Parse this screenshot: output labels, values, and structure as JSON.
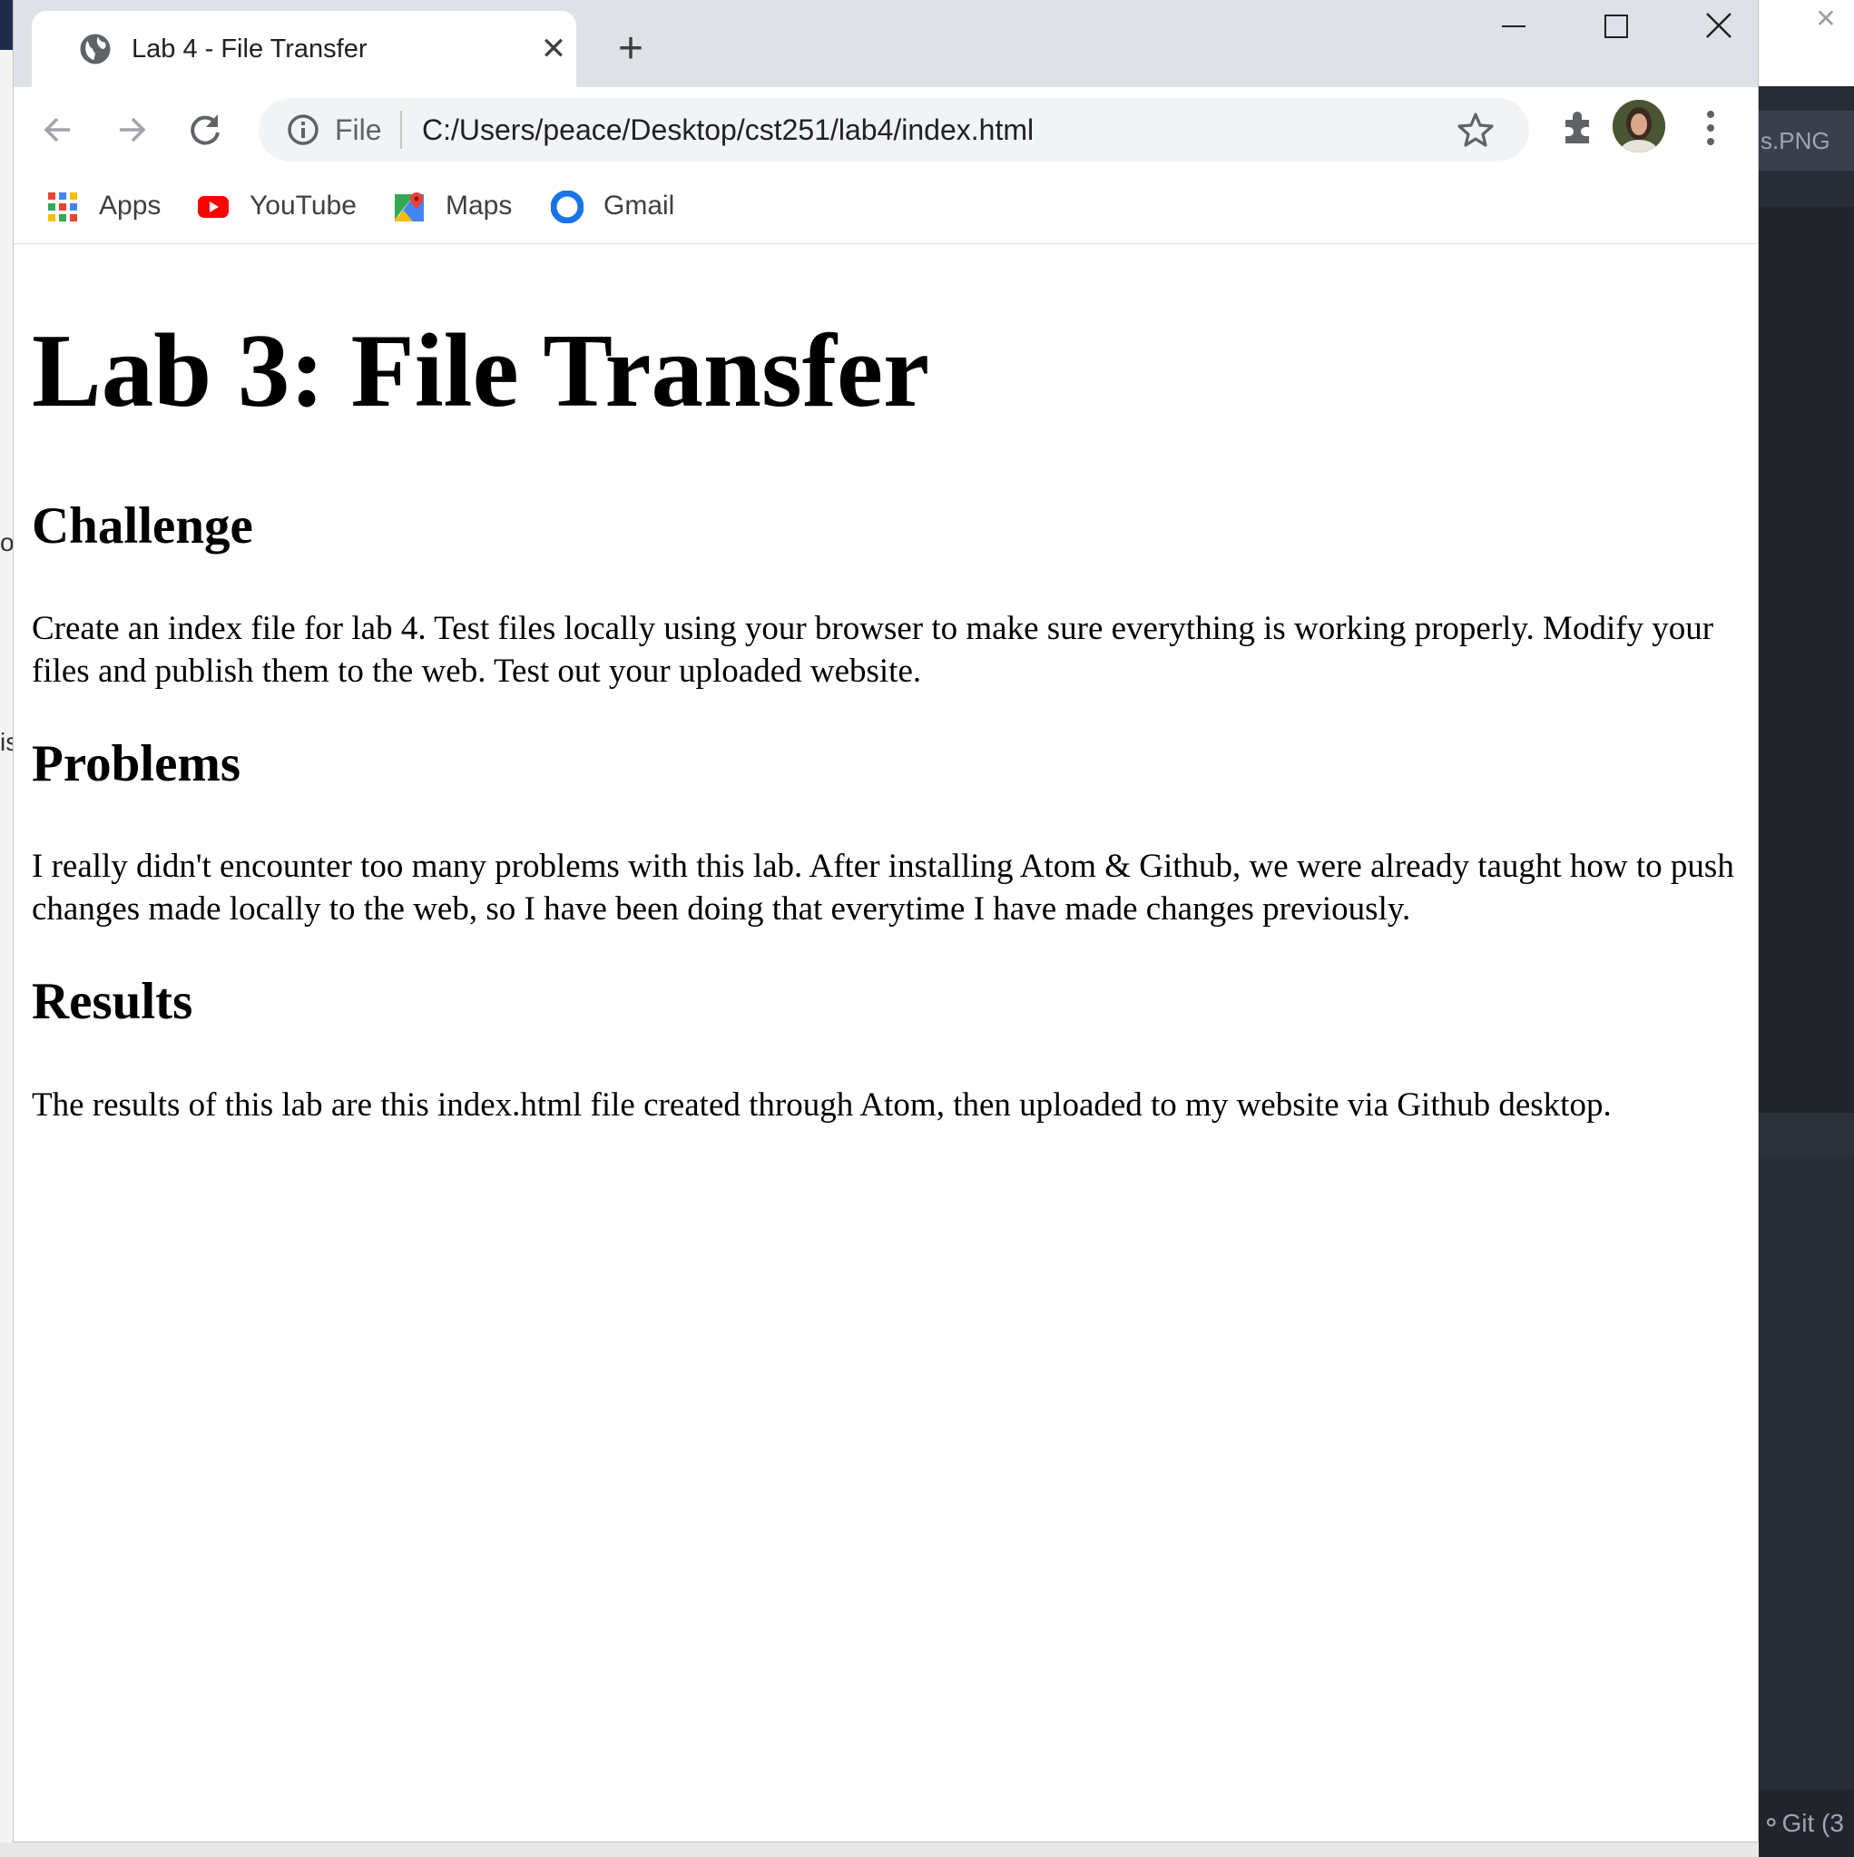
{
  "background": {
    "right_tab_label": "s.PNG",
    "status_git": "Git (3",
    "left_char_1": "o",
    "left_char_2": "is"
  },
  "browser": {
    "tab": {
      "title": "Lab 4 - File Transfer",
      "favicon": "globe-icon"
    },
    "address_bar": {
      "scheme_label": "File",
      "url": "C:/Users/peace/Desktop/cst251/lab4/index.html"
    },
    "bookmarks": [
      {
        "label": "Apps",
        "icon": "apps-grid-icon"
      },
      {
        "label": "YouTube",
        "icon": "youtube-icon"
      },
      {
        "label": "Maps",
        "icon": "maps-icon"
      },
      {
        "label": "Gmail",
        "icon": "gmail-icon"
      }
    ]
  },
  "page": {
    "title": "Lab 3: File Transfer",
    "sections": [
      {
        "heading": "Challenge",
        "body": "Create an index file for lab 4. Test files locally using your browser to make sure everything is working properly. Modify your files and publish them to the web. Test out your uploaded website."
      },
      {
        "heading": "Problems",
        "body": "I really didn't encounter too many problems with this lab. After installing Atom & Github, we were already taught how to push changes made locally to the web, so I have been doing that everytime I have made changes previously."
      },
      {
        "heading": "Results",
        "body": "The results of this lab are this index.html file created through Atom, then uploaded to my website via Github desktop."
      }
    ]
  },
  "colors": {
    "tabstrip": "#dee1e6",
    "omnibox": "#f1f3f4",
    "editor_dark": "#282c34"
  }
}
